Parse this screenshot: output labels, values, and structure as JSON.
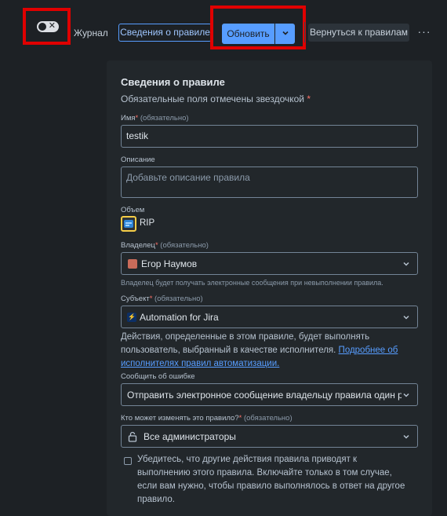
{
  "header": {
    "journal_label": "Журнал",
    "details_button": "Сведения о правиле",
    "update_button": "Обновить",
    "back_button": "Вернуться к правилам",
    "more_label": "···"
  },
  "form": {
    "title": "Сведения о правиле",
    "required_note": "Обязательные поля отмечены звездочкой",
    "required_star": "*",
    "required_suffix": "(обязательно)",
    "name": {
      "label": "Имя",
      "value": "testik"
    },
    "description": {
      "label": "Описание",
      "placeholder": "Добавьте описание правила"
    },
    "scope": {
      "label": "Объем",
      "value": "RIP"
    },
    "owner": {
      "label": "Владелец",
      "value": "Егор Наумов",
      "help": "Владелец будет получать электронные сообщения при невыполнении правила."
    },
    "actor": {
      "label": "Субъект",
      "value": "Automation for Jira",
      "help_text": "Действия, определенные в этом правиле, будет выполнять пользователь, выбранный в качестве исполнителя.",
      "help_link": "Подробнее об исполнителях правил автоматизации."
    },
    "notify": {
      "label": "Сообщить об ошибке",
      "value": "Отправить электронное сообщение владельцу правила один раз, ко..."
    },
    "editors": {
      "label": "Кто может изменять это правило?",
      "value": "Все администраторы"
    },
    "checkbox_text": "Убедитесь, что другие действия правила приводят к выполнению этого правила. Включайте только в том случае, если вам нужно, чтобы правило выполнялось в ответ на другое правило."
  },
  "colors": {
    "background": "#1d2125",
    "panel": "#22272b",
    "accent": "#579dff",
    "highlight": "#e00000"
  }
}
